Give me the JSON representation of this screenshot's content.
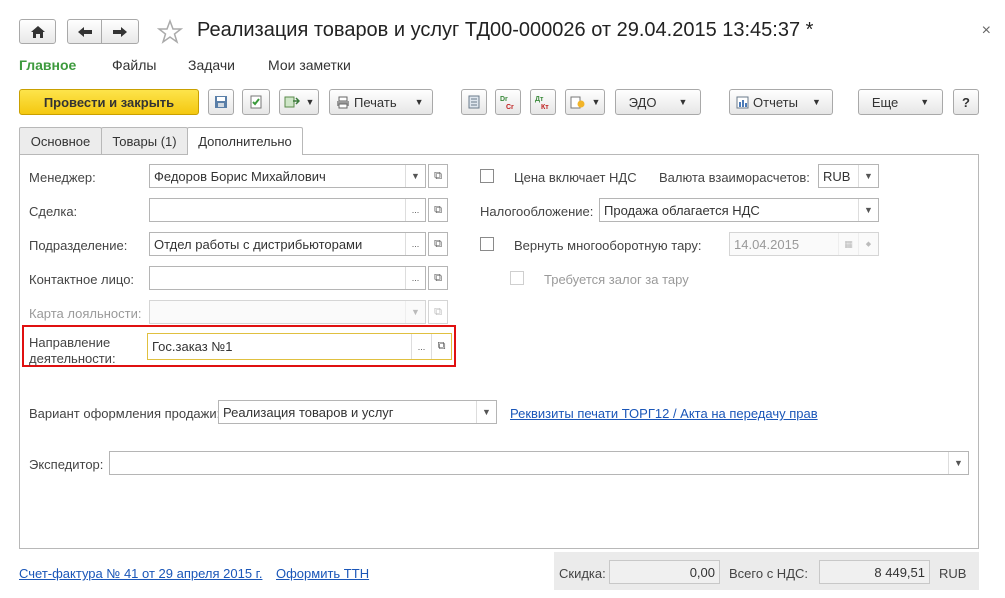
{
  "window": {
    "title": "Реализация товаров и услуг ТД00-000026 от 29.04.2015 13:45:37 *",
    "close_glyph": "×"
  },
  "sections": [
    {
      "label": "Главное"
    },
    {
      "label": "Файлы"
    },
    {
      "label": "Задачи"
    },
    {
      "label": "Мои заметки"
    }
  ],
  "toolbar": {
    "post_close": "Провести и закрыть",
    "print": "Печать",
    "edo": "ЭДО",
    "reports": "Отчеты",
    "more": "Еще",
    "help": "?",
    "dt_ct_1": "Dr Cr",
    "dt_ct_2": "Дт Кт"
  },
  "tabs": [
    {
      "label": "Основное"
    },
    {
      "label": "Товары (1)"
    },
    {
      "label": "Дополнительно"
    }
  ],
  "form": {
    "manager": {
      "label": "Менеджер:",
      "value": "Федоров Борис Михайлович"
    },
    "deal": {
      "label": "Сделка:",
      "value": ""
    },
    "department": {
      "label": "Подразделение:",
      "value": "Отдел работы с дистрибьюторами"
    },
    "contact": {
      "label": "Контактное лицо:",
      "value": ""
    },
    "loyalty": {
      "label": "Карта лояльности:",
      "value": ""
    },
    "direction": {
      "label_line1": "Направление",
      "label_line2": "деятельности:",
      "value": "Гос.заказ №1"
    },
    "price_vat": {
      "label": "Цена включает НДС"
    },
    "currency": {
      "label": "Валюта взаиморасчетов:",
      "value": "RUB"
    },
    "taxation": {
      "label": "Налогообложение:",
      "value": "Продажа облагается НДС"
    },
    "return_tare": {
      "label": "Вернуть многооборотную тару:",
      "date": "14.04.2015"
    },
    "deposit": {
      "label": "Требуется залог за тару"
    },
    "sale_variant": {
      "label": "Вариант оформления продажи:",
      "value": "Реализация товаров и услуг"
    },
    "print_link": "Реквизиты печати ТОРГ12 / Акта на передачу прав",
    "forwarder": {
      "label": "Экспедитор:",
      "value": ""
    }
  },
  "footer": {
    "invoice_link": "Счет-фактура № 41 от 29 апреля 2015 г.",
    "ttn_link": "Оформить ТТН",
    "discount_label": "Скидка:",
    "discount_value": "0,00",
    "total_label": "Всего с НДС:",
    "total_value": "8 449,51",
    "currency": "RUB"
  },
  "colors": {
    "highlight_border": "#e01010",
    "active_section": "#3d9a3d",
    "primary_button": "#f4c810",
    "link": "#1a56b8"
  }
}
